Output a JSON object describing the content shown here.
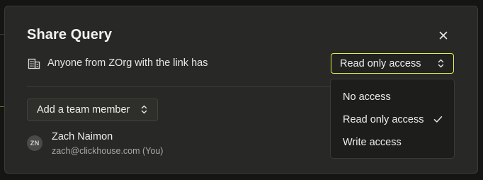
{
  "modal": {
    "title": "Share Query",
    "close_icon": "close-icon"
  },
  "link_access": {
    "icon": "building-icon",
    "text": "Anyone from ZOrg with the link has",
    "selected": "Read only access"
  },
  "team": {
    "add_label": "Add a team member"
  },
  "members": [
    {
      "initials": "ZN",
      "name": "Zach Naimon",
      "email": "zach@clickhouse.com (You)"
    }
  ],
  "dropdown": {
    "options": [
      {
        "label": "No access",
        "selected": false
      },
      {
        "label": "Read only access",
        "selected": true
      },
      {
        "label": "Write access",
        "selected": false
      }
    ]
  },
  "colors": {
    "accent_focus": "#e4f045",
    "modal_bg": "#282826",
    "dropdown_bg": "#1d1d1b"
  }
}
